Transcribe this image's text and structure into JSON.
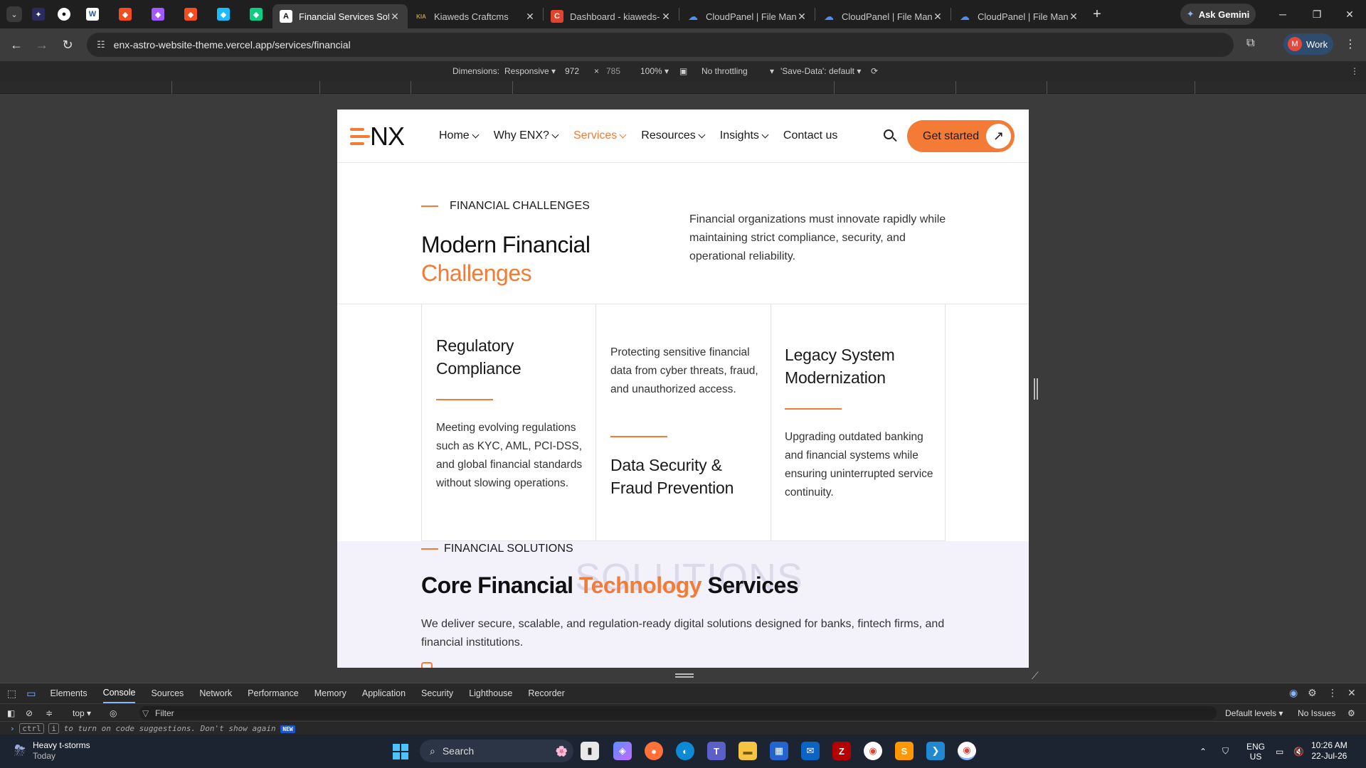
{
  "browser": {
    "tabs": [
      {
        "title": "Financial Services Softw",
        "active": true
      },
      {
        "title": "Kiaweds Craftcms",
        "active": false
      },
      {
        "title": "Dashboard - kiaweds-c",
        "active": false
      },
      {
        "title": "CloudPanel | File Mana",
        "active": false
      },
      {
        "title": "CloudPanel | File Mana",
        "active": false
      },
      {
        "title": "CloudPanel | File Mana",
        "active": false
      }
    ],
    "favicon_letters": {
      "kiaweds": "KIA",
      "dashboard": "C",
      "word": "W",
      "financial": "A"
    },
    "gemini_label": "Ask Gemini",
    "url": "enx-astro-website-theme.vercel.app/services/financial",
    "profile_initial": "M",
    "profile_label": "Work"
  },
  "device_toolbar": {
    "dimensions_label": "Dimensions:",
    "mode": "Responsive",
    "width": "972",
    "times": "×",
    "height": "785",
    "zoom": "100%",
    "throttling": "No throttling",
    "save_data": "'Save-Data': default"
  },
  "site": {
    "logo_text": "NX",
    "nav": [
      {
        "label": "Home",
        "active": false
      },
      {
        "label": "Why ENX?",
        "active": false
      },
      {
        "label": "Services",
        "active": true
      },
      {
        "label": "Resources",
        "active": false
      },
      {
        "label": "Insights",
        "active": false
      },
      {
        "label": "Contact us",
        "active": false
      }
    ],
    "cta_label": "Get started",
    "cta_arrow": "↗",
    "colors": {
      "accent": "#f47b35",
      "solutions_bg": "#f3f2fb"
    },
    "challenges": {
      "eyebrow": "FINANCIAL CHALLENGES",
      "title_line1": "Modern Financial",
      "title_accent": "Challenges",
      "description": "Financial organizations must innovate rapidly while maintaining strict compliance, security, and operational reliability.",
      "cards": [
        {
          "title": "Regulatory Compliance",
          "text": "Meeting evolving regulations such as KYC, AML, PCI-DSS, and global financial standards without slowing operations."
        },
        {
          "title": "Data Security & Fraud Prevention",
          "text": "Protecting sensitive financial data from cyber threats, fraud, and unauthorized access."
        },
        {
          "title": "Legacy System Modernization",
          "text": "Upgrading outdated banking and financial systems while ensuring uninterrupted service continuity."
        }
      ]
    },
    "solutions": {
      "eyebrow": "FINANCIAL SOLUTIONS",
      "ghost_text": "SOLUTIONS",
      "title_before": "Core Financial ",
      "title_accent": "Technology",
      "title_after": " Services",
      "description": "We deliver secure, scalable, and regulation-ready digital solutions designed for banks, fintech firms, and financial institutions."
    }
  },
  "devtools": {
    "tabs": [
      {
        "label": "Elements",
        "active": false
      },
      {
        "label": "Console",
        "active": true
      },
      {
        "label": "Sources",
        "active": false
      },
      {
        "label": "Network",
        "active": false
      },
      {
        "label": "Performance",
        "active": false
      },
      {
        "label": "Memory",
        "active": false
      },
      {
        "label": "Application",
        "active": false
      },
      {
        "label": "Security",
        "active": false
      },
      {
        "label": "Lighthouse",
        "active": false
      },
      {
        "label": "Recorder",
        "active": false
      }
    ],
    "context": "top",
    "filter_placeholder": "Filter",
    "levels": "Default levels",
    "issues": "No Issues",
    "hint_key1": "ctrl",
    "hint_key2": "i",
    "hint_text": "to turn on code suggestions. Don't show again",
    "new_badge": "NEW"
  },
  "taskbar": {
    "weather_title": "Heavy t-storms",
    "weather_sub": "Today",
    "search_label": "Search",
    "lang": "ENG",
    "region": "US",
    "time": "10:26 AM",
    "date": "22-Jul-26",
    "app_letters": {
      "filezilla": "Z",
      "sublime": "S"
    }
  }
}
